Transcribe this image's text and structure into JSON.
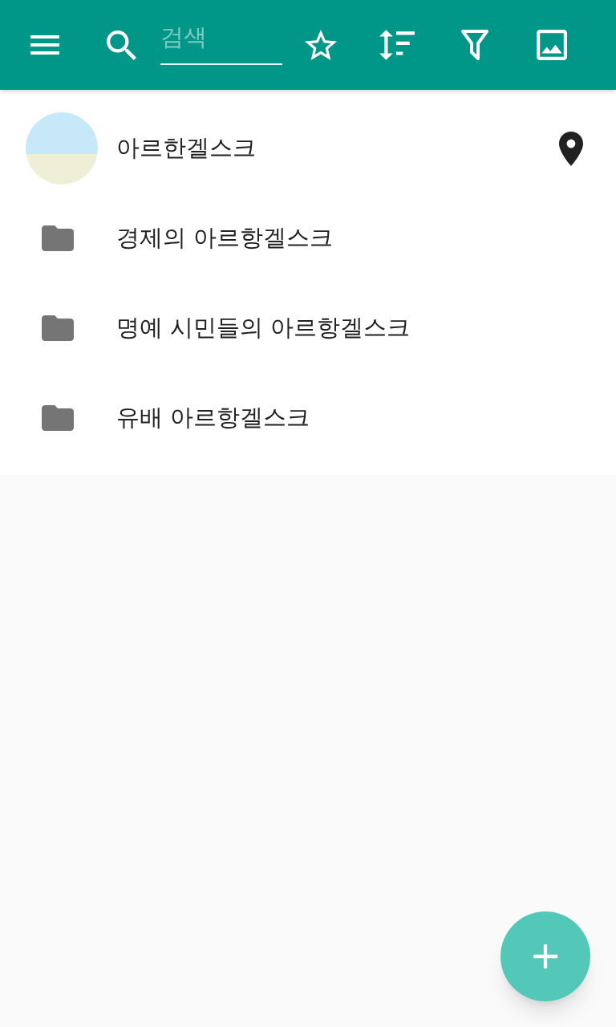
{
  "toolbar": {
    "search": {
      "placeholder": "검색"
    }
  },
  "items": [
    {
      "kind": "place",
      "label": "아르한겔스크"
    },
    {
      "kind": "folder",
      "label": "경제의 아르항겔스크"
    },
    {
      "kind": "folder",
      "label": "명예 시민들의 아르항겔스크"
    },
    {
      "kind": "folder",
      "label": "유배 아르항겔스크"
    }
  ]
}
